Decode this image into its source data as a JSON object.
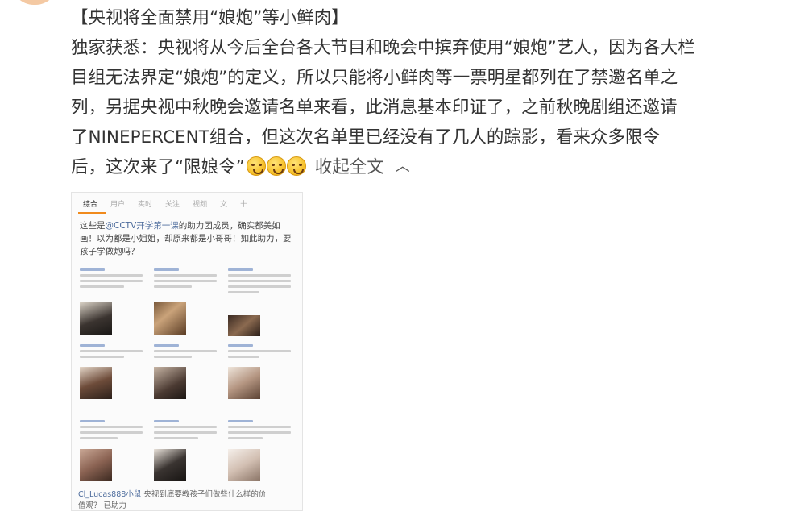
{
  "post": {
    "title_line": "【央视将全面禁用“娘炮”等小鲜肉】",
    "lines": [
      "独家获悉：央视将从今后全台各大节目和晚会中摈弃使用“娘炮”艺人，因为各大栏",
      "目组无法界定“娘炮”的定义，所以只能将小鲜肉等一票明星都列在了禁邀名单之",
      "列，另据央视中秋晚会邀请名单来看，此消息基本印证了，之前秋晚剧组还邀请",
      "了NINEPERCENT组合，但这次名单里已经没有了几人的踪影，看来众多限令"
    ],
    "last_line": "后，这次来了“限娘令”",
    "collapse_label": "收起全文",
    "collapse_icon": "chevron-up-icon"
  },
  "screenshot": {
    "tabs": [
      "综合",
      "用户",
      "实时",
      "关注",
      "视频",
      "文",
      "十"
    ],
    "quote_prefix": "这些是",
    "quote_at": "@CCTV开学第一课",
    "quote_rest": "的助力团成员，确实都美如画！以为都是小姐姐，却原来都是小哥哥！如此助力，要孩子学做炮吗？",
    "foot_at": "Cl_Lucas888小鼠",
    "foot_rest": "央视到底要教孩子们做些什么样的价",
    "foot_line2": "值观？ 已助力"
  }
}
